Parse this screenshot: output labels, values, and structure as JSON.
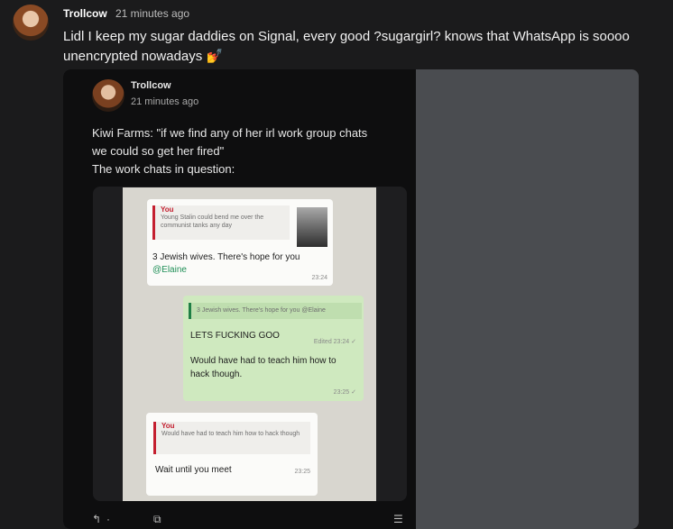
{
  "comment": {
    "author": "Trollcow",
    "time": "21 minutes ago",
    "text": "Lidl I keep my sugar daddies on Signal, every good ?sugargirl? knows that WhatsApp is soooo unencrypted nowadays 💅"
  },
  "embedded_post": {
    "author": "Trollcow",
    "time": "21 minutes ago",
    "lines": [
      "Kiwi Farms: \"if we find any of her irl work group chats",
      "we could so get her fired\"",
      "The work chats in question:"
    ],
    "chat": {
      "message1": {
        "quote_name": "You",
        "quote_text": "Young Stalin could bend me over the communist tanks any day",
        "text": "3 Jewish wives. There's hope for you",
        "mention": "@Elaine",
        "time": "23:24"
      },
      "message2": {
        "quote_text": "3 Jewish wives. There's hope for you @Elaine",
        "text1": "LETS FUCKING GOO",
        "time1": "Edited 23:24 ✓",
        "text2": "Would have had to teach him how to hack though.",
        "time2": "23:25 ✓"
      },
      "message3": {
        "quote_name": "You",
        "quote_text": "Would have had to teach him how to hack though",
        "text": "Wait until you meet",
        "time": "23:25"
      }
    }
  }
}
